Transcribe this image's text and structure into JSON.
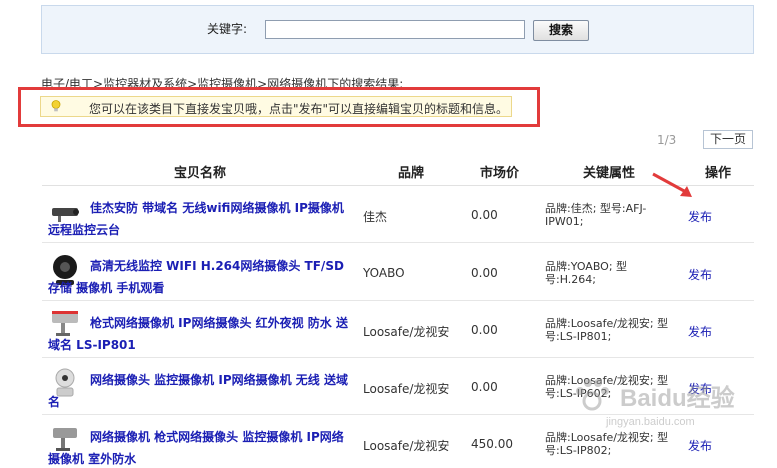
{
  "search": {
    "label": "关键字:",
    "value": "",
    "placeholder": "",
    "button": "搜索"
  },
  "breadcrumb": "电子/电工>监控器材及系统>监控摄像机>网络摄像机下的搜索结果:",
  "tip": "您可以在该类目下直接发宝贝哦，点击\"发布\"可以直接编辑宝贝的标题和信息。",
  "pager": {
    "count": "1/3",
    "next": "下一页"
  },
  "table": {
    "headers": {
      "name": "宝贝名称",
      "brand": "品牌",
      "price": "市场价",
      "attr": "关键属性",
      "op": "操作"
    },
    "rows": [
      {
        "name": "佳杰安防 带域名 无线wifi网络摄像机 IP摄像机 远程监控云台",
        "brand": "佳杰",
        "price": "0.00",
        "attr": "品牌:佳杰; 型号:AFJ-IPW01;",
        "op": "发布"
      },
      {
        "name": "高清无线监控 WIFI H.264网络摄像头 TF/SD存储 摄像机 手机观看",
        "brand": "YOABO",
        "price": "0.00",
        "attr": "品牌:YOABO; 型号:H.264;",
        "op": "发布"
      },
      {
        "name": "枪式网络摄像机 IP网络摄像头 红外夜视 防水 送域名 LS-IP801",
        "brand": "Loosafe/龙视安",
        "price": "0.00",
        "attr": "品牌:Loosafe/龙视安; 型号:LS-IP801;",
        "op": "发布"
      },
      {
        "name": "网络摄像头 监控摄像机 IP网络摄像机 无线 送域名",
        "brand": "Loosafe/龙视安",
        "price": "0.00",
        "attr": "品牌:Loosafe/龙视安; 型号:LS-IP602;",
        "op": "发布"
      },
      {
        "name": "网络摄像机 枪式网络摄像头 监控摄像机 IP网络摄像机 室外防水",
        "brand": "Loosafe/龙视安",
        "price": "450.00",
        "attr": "品牌:Loosafe/龙视安; 型号:LS-IP802;",
        "op": "发布"
      }
    ]
  },
  "watermark": {
    "text": "Baidu经验",
    "url": "jingyan.baidu.com"
  },
  "colors": {
    "link": "#1b1fb4",
    "highlight": "#e23b3b",
    "panel": "#eef4fb",
    "tip_bg": "#fffbe3"
  }
}
